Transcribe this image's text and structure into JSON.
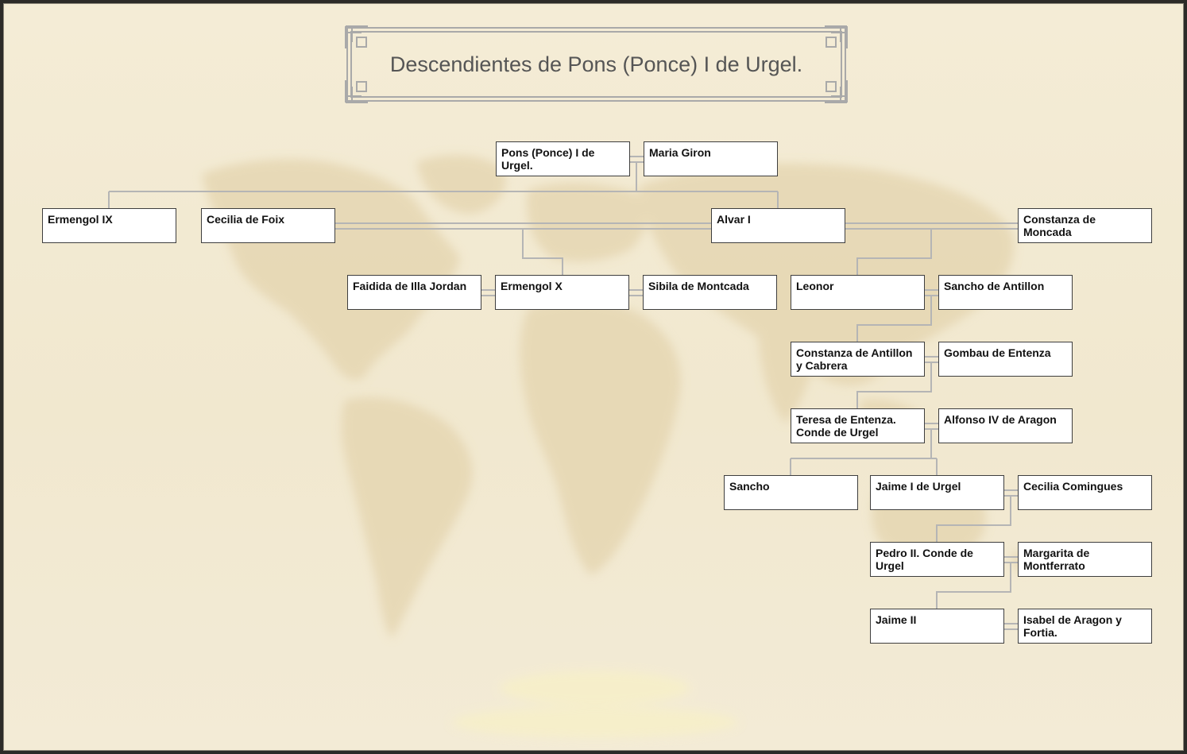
{
  "title": "Descendientes de Pons (Ponce) I de Urgel.",
  "colors": {
    "background": "#f2ead3",
    "map": "#e5d6b1",
    "connector": "#b5b5b5",
    "frame": "#2c2b28"
  },
  "people": {
    "pons": "Pons (Ponce) I de Urgel.",
    "maria_giron": "Maria Giron",
    "ermengol_ix": "Ermengol IX",
    "cecilia_foix": "Cecilia de Foix",
    "alvar_i": "Alvar I",
    "constanza_moncada": "Constanza de Moncada",
    "faidida": "Faidida de Illa Jordan",
    "ermengol_x": "Ermengol X",
    "sibila": "Sibila de Montcada",
    "leonor": "Leonor",
    "sancho_antillon": "Sancho de Antillon",
    "constanza_antillon": "Constanza de Antillon y Cabrera",
    "gombau": "Gombau de Entenza",
    "teresa": "Teresa de Entenza. Conde de Urgel",
    "alfonso_iv": "Alfonso IV de Aragon",
    "sancho": "Sancho",
    "jaime_i": "Jaime I de Urgel",
    "cecilia_comingues": "Cecilia Comingues",
    "pedro_ii": "Pedro II. Conde de Urgel",
    "margarita": "Margarita de Montferrato",
    "jaime_ii": "Jaime II",
    "isabel": "Isabel de Aragon y Fortia."
  }
}
